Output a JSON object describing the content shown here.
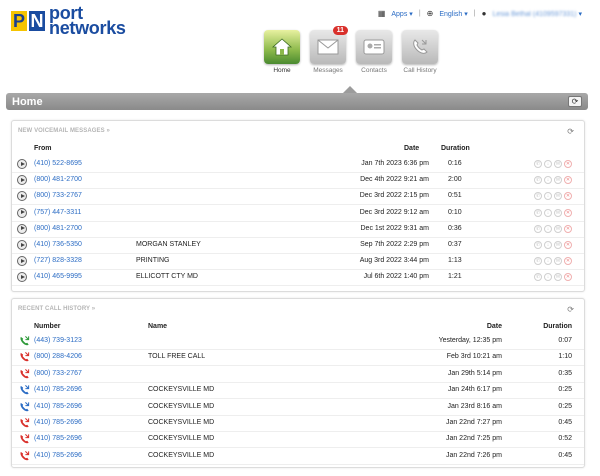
{
  "brand": {
    "logo_p": "P",
    "logo_n": "N",
    "line1": "port",
    "line2": "networks"
  },
  "topbar": {
    "apps": "Apps",
    "language": "English",
    "user": "Lesia Bethal (4109597331)"
  },
  "nav": [
    {
      "label": "Home",
      "icon": "home-icon",
      "badge": ""
    },
    {
      "label": "Messages",
      "icon": "envelope-icon",
      "badge": "11"
    },
    {
      "label": "Contacts",
      "icon": "contact-card-icon",
      "badge": ""
    },
    {
      "label": "Call History",
      "icon": "phone-icon",
      "badge": ""
    }
  ],
  "page": {
    "title": "Home"
  },
  "voicemail": {
    "title": "NEW VOICEMAIL MESSAGES »",
    "headers": {
      "from": "From",
      "date": "Date",
      "duration": "Duration"
    },
    "rows": [
      {
        "number": "(410) 522-8695",
        "name": "",
        "date": "Jan 7th 2023 6:36 pm",
        "duration": "0:16"
      },
      {
        "number": "(800) 481-2700",
        "name": "",
        "date": "Dec 4th 2022 9:21 am",
        "duration": "2:00"
      },
      {
        "number": "(800) 733-2767",
        "name": "",
        "date": "Dec 3rd 2022 2:15 pm",
        "duration": "0:51"
      },
      {
        "number": "(757) 447-3311",
        "name": "",
        "date": "Dec 3rd 2022 9:12 am",
        "duration": "0:10"
      },
      {
        "number": "(800) 481-2700",
        "name": "",
        "date": "Dec 1st 2022 9:31 am",
        "duration": "0:36"
      },
      {
        "number": "(410) 736-5350",
        "name": "MORGAN STANLEY",
        "date": "Sep 7th 2022 2:29 pm",
        "duration": "0:37"
      },
      {
        "number": "(727) 828-3328",
        "name": "PRINTING",
        "date": "Aug 3rd 2022 3:44 pm",
        "duration": "1:13"
      },
      {
        "number": "(410) 465-9995",
        "name": "ELLICOTT CTY MD",
        "date": "Jul 6th 2022 1:40 pm",
        "duration": "1:21"
      }
    ]
  },
  "calls": {
    "title": "RECENT CALL HISTORY »",
    "headers": {
      "number": "Number",
      "name": "Name",
      "date": "Date",
      "duration": "Duration"
    },
    "rows": [
      {
        "type": "incoming",
        "color": "#2e9a3a",
        "number": "(443) 739-3123",
        "name": "",
        "date": "Yesterday, 12:35 pm",
        "duration": "0:07"
      },
      {
        "type": "missed",
        "color": "#d9302b",
        "number": "(800) 288-4206",
        "name": "TOLL FREE CALL",
        "date": "Feb 3rd 10:21 am",
        "duration": "1:10"
      },
      {
        "type": "missed",
        "color": "#d9302b",
        "number": "(800) 733-2767",
        "name": "",
        "date": "Jan 29th 5:14 pm",
        "duration": "0:35"
      },
      {
        "type": "outgoing",
        "color": "#2b6cc4",
        "number": "(410) 785-2696",
        "name": "COCKEYSVILLE MD",
        "date": "Jan 24th 6:17 pm",
        "duration": "0:25"
      },
      {
        "type": "outgoing",
        "color": "#2b6cc4",
        "number": "(410) 785-2696",
        "name": "COCKEYSVILLE MD",
        "date": "Jan 23rd 8:16 am",
        "duration": "0:25"
      },
      {
        "type": "missed",
        "color": "#d9302b",
        "number": "(410) 785-2696",
        "name": "COCKEYSVILLE MD",
        "date": "Jan 22nd 7:27 pm",
        "duration": "0:45"
      },
      {
        "type": "missed",
        "color": "#d9302b",
        "number": "(410) 785-2696",
        "name": "COCKEYSVILLE MD",
        "date": "Jan 22nd 7:25 pm",
        "duration": "0:52"
      },
      {
        "type": "missed",
        "color": "#d9302b",
        "number": "(410) 785-2696",
        "name": "COCKEYSVILLE MD",
        "date": "Jan 22nd 7:26 pm",
        "duration": "0:45"
      }
    ]
  }
}
